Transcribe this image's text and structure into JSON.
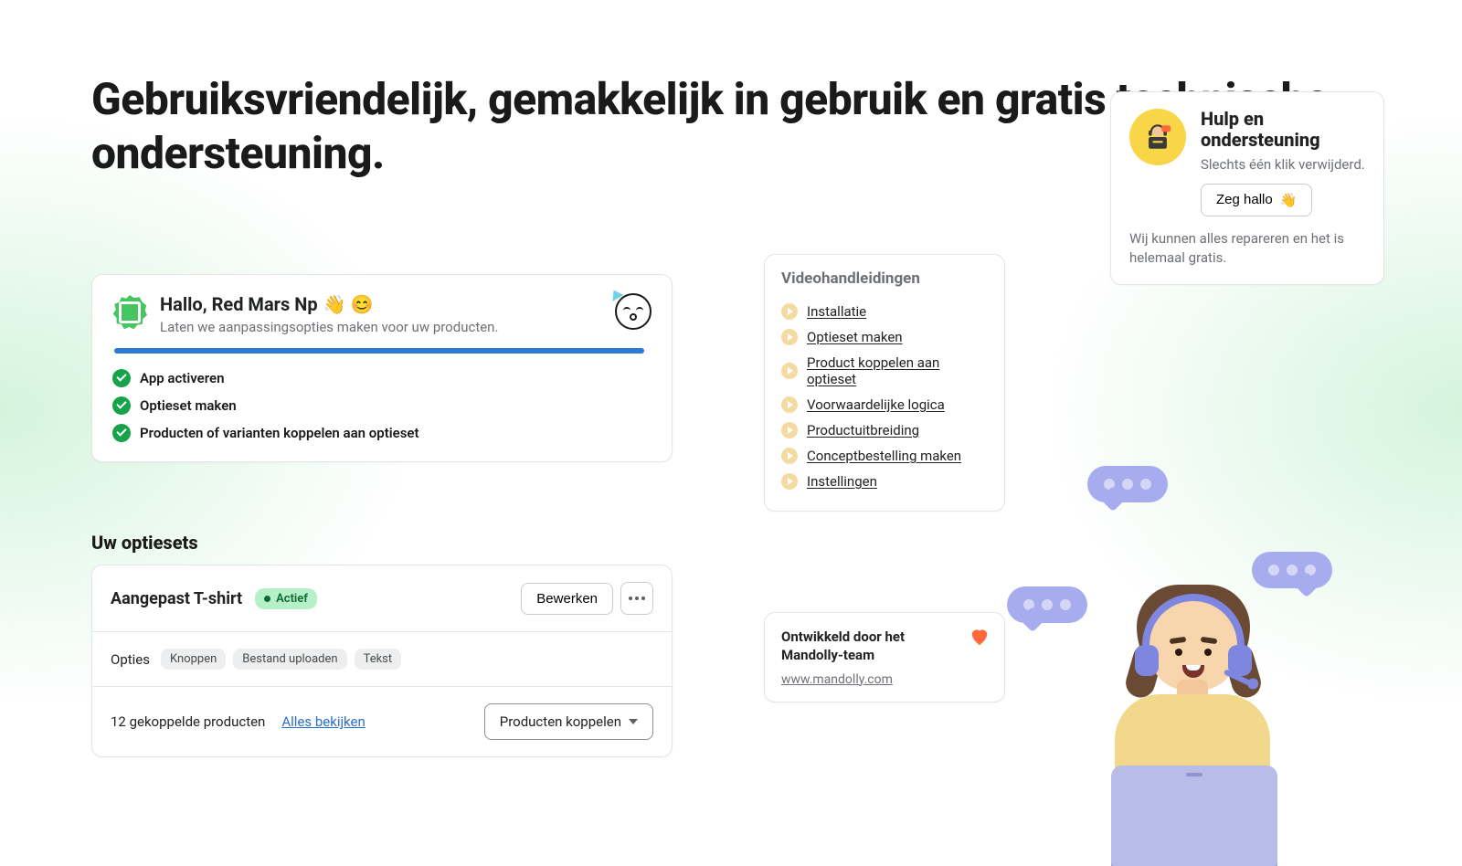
{
  "heading": "Gebruiksvriendelijk, gemakkelijk in gebruik en gratis technische ondersteuning.",
  "welcome": {
    "greeting": "Hallo, Red Mars Np",
    "emoji": "👋 😊",
    "subtitle": "Laten we aanpassingsopties maken voor uw producten.",
    "steps": [
      "App activeren",
      "Optieset maken",
      "Producten of varianten koppelen aan optieset"
    ]
  },
  "videos": {
    "title": "Videohandleidingen",
    "items": [
      "Installatie",
      "Optieset maken",
      "Product koppelen aan optieset",
      "Voorwaardelijke logica",
      "Productuitbreiding",
      "Conceptbestelling maken",
      "Instellingen"
    ]
  },
  "optionsets": {
    "heading": "Uw optiesets",
    "title": "Aangepast T-shirt",
    "status": "Actief",
    "edit": "Bewerken",
    "options_label": "Opties",
    "chips": [
      "Knoppen",
      "Bestand uploaden",
      "Tekst"
    ],
    "linked_count": "12 gekoppelde producten",
    "view_all": "Alles bekijken",
    "link_products": "Producten koppelen"
  },
  "developed": {
    "title": "Ontwikkeld door het Mandolly-team",
    "link": "www.mandolly.com"
  },
  "help": {
    "title": "Hulp en ondersteuning",
    "subtitle": "Slechts één klik verwijderd.",
    "cta": "Zeg hallo",
    "cta_emoji": "👋",
    "footer": "Wij kunnen alles repareren en het is helemaal gratis."
  }
}
